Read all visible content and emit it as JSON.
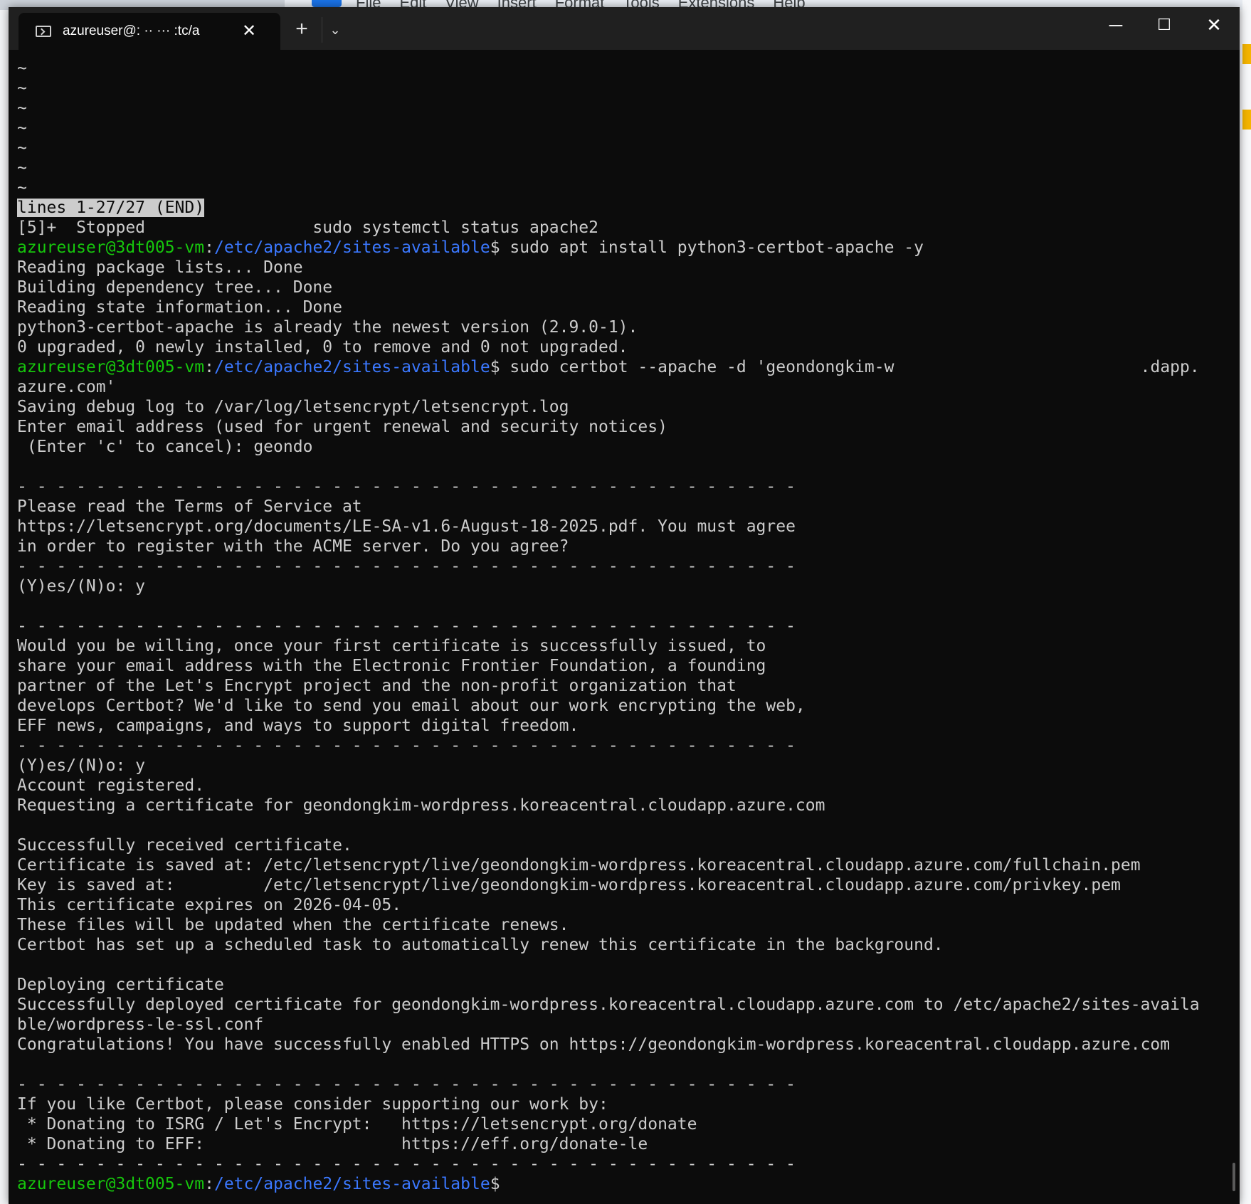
{
  "background_app": {
    "menu": [
      "File",
      "Edit",
      "View",
      "Insert",
      "Format",
      "Tools",
      "Extensions",
      "Help"
    ]
  },
  "tab": {
    "title": "azureuser@:  ··  ··· :tc/a",
    "icon": "terminal-icon",
    "close": "✕"
  },
  "titlebar": {
    "new_tab": "+",
    "dropdown": "⌄",
    "minimize": "─",
    "maximize": "☐",
    "close": "✕"
  },
  "prompt": {
    "user_host": "azureuser@3dt005-vm",
    "sep": ":",
    "path": "/etc/apache2/sites-available",
    "dollar": "$"
  },
  "colors": {
    "prompt_green": "#16c60c",
    "path_blue": "#3b78ff",
    "text": "#cccccc",
    "background": "#0c0c0c"
  },
  "lines": {
    "tilde": [
      "~",
      "~",
      "~",
      "~",
      "~",
      "~",
      "~"
    ],
    "less_status": "lines 1-27/27 (END)",
    "job_stopped": "[5]+  Stopped                 sudo systemctl status apache2",
    "cmd1": " sudo apt install python3-certbot-apache -y",
    "apt_output": [
      "Reading package lists... Done",
      "Building dependency tree... Done",
      "Reading state information... Done",
      "python3-certbot-apache is already the newest version (2.9.0-1).",
      "0 upgraded, 0 newly installed, 0 to remove and 0 not upgraded."
    ],
    "cmd2": " sudo certbot --apache -d 'geondongkim-w                         .dapp.",
    "cmd2_wrap": "azure.com'",
    "certbot_output_1": [
      "Saving debug log to /var/log/letsencrypt/letsencrypt.log",
      "Enter email address (used for urgent renewal and security notices)",
      " (Enter 'c' to cancel): geondo",
      "",
      "- - - - - - - - - - - - - - - - - - - - - - - - - - - - - - - - - - - - - - - -",
      "Please read the Terms of Service at",
      "https://letsencrypt.org/documents/LE-SA-v1.6-August-18-2025.pdf. You must agree",
      "in order to register with the ACME server. Do you agree?",
      "- - - - - - - - - - - - - - - - - - - - - - - - - - - - - - - - - - - - - - - -",
      "(Y)es/(N)o: y",
      "",
      "- - - - - - - - - - - - - - - - - - - - - - - - - - - - - - - - - - - - - - - -",
      "Would you be willing, once your first certificate is successfully issued, to",
      "share your email address with the Electronic Frontier Foundation, a founding",
      "partner of the Let's Encrypt project and the non-profit organization that",
      "develops Certbot? We'd like to send you email about our work encrypting the web,",
      "EFF news, campaigns, and ways to support digital freedom.",
      "- - - - - - - - - - - - - - - - - - - - - - - - - - - - - - - - - - - - - - - -",
      "(Y)es/(N)o: y",
      "Account registered.",
      "Requesting a certificate for geondongkim-wordpress.koreacentral.cloudapp.azure.com",
      "",
      "Successfully received certificate.",
      "Certificate is saved at: /etc/letsencrypt/live/geondongkim-wordpress.koreacentral.cloudapp.azure.com/fullchain.pem",
      "Key is saved at:         /etc/letsencrypt/live/geondongkim-wordpress.koreacentral.cloudapp.azure.com/privkey.pem",
      "This certificate expires on 2026-04-05.",
      "These files will be updated when the certificate renews.",
      "Certbot has set up a scheduled task to automatically renew this certificate in the background.",
      "",
      "Deploying certificate",
      "Successfully deployed certificate for geondongkim-wordpress.koreacentral.cloudapp.azure.com to /etc/apache2/sites-availa",
      "ble/wordpress-le-ssl.conf",
      "Congratulations! You have successfully enabled HTTPS on https://geondongkim-wordpress.koreacentral.cloudapp.azure.com",
      "",
      "- - - - - - - - - - - - - - - - - - - - - - - - - - - - - - - - - - - - - - - -",
      "If you like Certbot, please consider supporting our work by:",
      " * Donating to ISRG / Let's Encrypt:   https://letsencrypt.org/donate",
      " * Donating to EFF:                    https://eff.org/donate-le",
      "- - - - - - - - - - - - - - - - - - - - - - - - - - - - - - - - - - - - - - - -"
    ]
  }
}
